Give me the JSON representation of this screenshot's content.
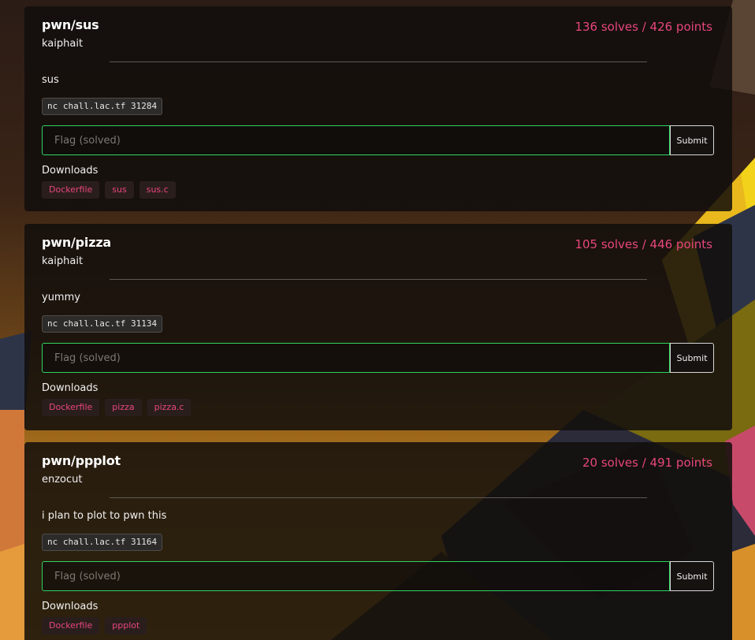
{
  "theme": {
    "accent": "#e8467c",
    "success_border": "#2fd35f",
    "card_bg": "#120e0c"
  },
  "challenges": [
    {
      "title": "pwn/sus",
      "author": "kaiphait",
      "score": "136 solves / 426 points",
      "description": "sus",
      "connection": "nc chall.lac.tf 31284",
      "flag_placeholder": "Flag (solved)",
      "submit_label": "Submit",
      "downloads_label": "Downloads",
      "downloads": [
        "Dockerfile",
        "sus",
        "sus.c"
      ]
    },
    {
      "title": "pwn/pizza",
      "author": "kaiphait",
      "score": "105 solves / 446 points",
      "description": "yummy",
      "connection": "nc chall.lac.tf 31134",
      "flag_placeholder": "Flag (solved)",
      "submit_label": "Submit",
      "downloads_label": "Downloads",
      "downloads": [
        "Dockerfile",
        "pizza",
        "pizza.c"
      ]
    },
    {
      "title": "pwn/ppplot",
      "author": "enzocut",
      "score": "20 solves / 491 points",
      "description": "i plan to plot to pwn this",
      "connection": "nc chall.lac.tf 31164",
      "flag_placeholder": "Flag (solved)",
      "submit_label": "Submit",
      "downloads_label": "Downloads",
      "downloads": [
        "Dockerfile",
        "ppplot"
      ]
    }
  ]
}
